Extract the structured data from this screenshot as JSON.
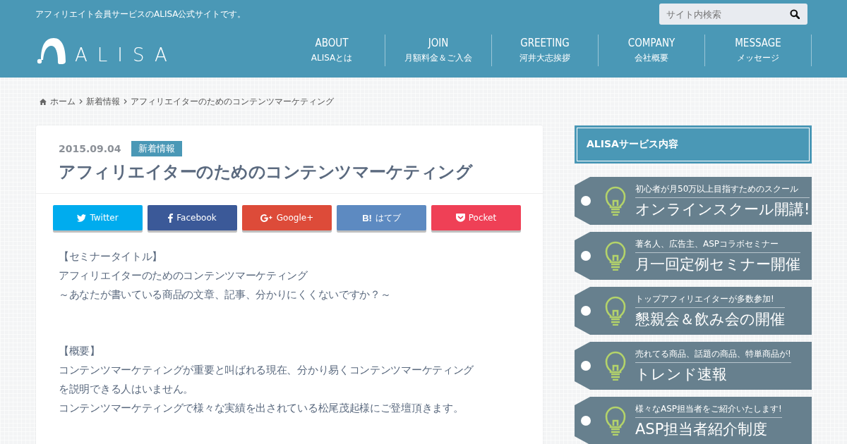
{
  "header": {
    "tagline": "アフィリエイト会員サービスのALISA公式サイトです。",
    "search": {
      "placeholder": "サイト内検索"
    },
    "logo": "ALISA",
    "nav": [
      {
        "title": "ABOUT",
        "sub": "ALISAとは"
      },
      {
        "title": "JOIN",
        "sub": "月額料金＆ご入会"
      },
      {
        "title": "GREETING",
        "sub": "河井大志挨拶"
      },
      {
        "title": "COMPANY",
        "sub": "会社概要"
      },
      {
        "title": "MESSAGE",
        "sub": "メッセージ"
      }
    ]
  },
  "breadcrumb": [
    "ホーム",
    "新着情報",
    "アフィリエイターのためのコンテンツマーケティング"
  ],
  "article": {
    "date": "2015.09.04",
    "category": "新着情報",
    "title": "アフィリエイターのためのコンテンツマーケティング",
    "share": [
      {
        "kind": "twitter",
        "label": "Twitter"
      },
      {
        "kind": "facebook",
        "label": "Facebook"
      },
      {
        "kind": "google",
        "label": "Google+"
      },
      {
        "kind": "hatena",
        "label": "はてブ",
        "mark": "B!"
      },
      {
        "kind": "pocket",
        "label": "Pocket"
      }
    ],
    "body": [
      [
        "【セミナータイトル】",
        "アフィリエイターのためのコンテンツマーケティング",
        "～あなたが書いている商品の文章、記事、分かりにくくないですか？～"
      ],
      [
        "【概要】",
        "コンテンツマーケティングが重要と叫ばれる現在、分かり易くコンテンツマーケティング",
        "を説明できる人はいません。",
        "コンテンツマーケティングで様々な実績を出されている松尾茂起様にご登壇頂きます。"
      ]
    ]
  },
  "sidebar": {
    "heading": "ALISAサービス内容",
    "banners": [
      {
        "sub": "初心者が月50万以上目指すためのスクール",
        "main": "オンラインスクール開講!"
      },
      {
        "sub": "著名人、広告主、ASPコラボセミナー",
        "main": "月一回定例セミナー開催"
      },
      {
        "sub": "トップアフィリエイターが多数参加!",
        "main": "懇親会＆飲み会の開催"
      },
      {
        "sub": "売れてる商品、話題の商品、特単商品が!",
        "main": "トレンド速報"
      },
      {
        "sub": "様々なASP担当者をご紹介いたします!",
        "main": "ASP担当者紹介制度"
      }
    ]
  }
}
